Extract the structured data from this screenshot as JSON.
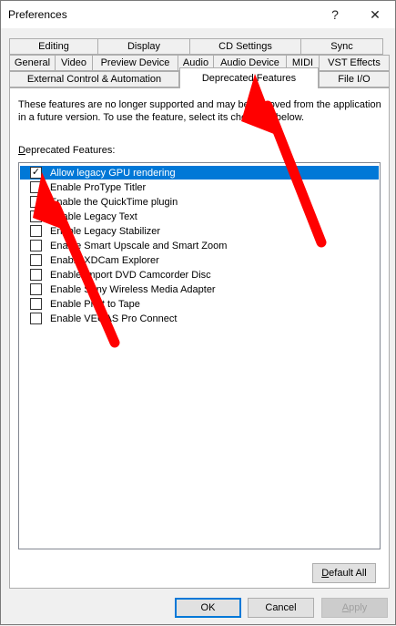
{
  "window": {
    "title": "Preferences",
    "help_glyph": "?",
    "close_glyph": "✕"
  },
  "tabs": {
    "row1": [
      "Editing",
      "Display",
      "CD Settings",
      "Sync"
    ],
    "row2": [
      "General",
      "Video",
      "Preview Device",
      "Audio",
      "Audio Device",
      "MIDI",
      "VST Effects"
    ],
    "row3": [
      "External Control & Automation",
      "Deprecated Features",
      "File I/O"
    ],
    "active": "Deprecated Features"
  },
  "panel": {
    "description": "These features are no longer supported and may be removed from the application in a future version. To use the feature, select its checkbox below.",
    "list_label_mnemonic": "D",
    "list_label_rest": "eprecated Features:",
    "items": [
      {
        "label": "Allow legacy GPU rendering",
        "checked": true,
        "selected": true
      },
      {
        "label": "Enable ProType Titler",
        "checked": false,
        "selected": false
      },
      {
        "label": "Enable the QuickTime plugin",
        "checked": false,
        "selected": false
      },
      {
        "label": "Enable Legacy Text",
        "checked": false,
        "selected": false
      },
      {
        "label": "Enable Legacy Stabilizer",
        "checked": false,
        "selected": false
      },
      {
        "label": "Enable Smart Upscale and Smart Zoom",
        "checked": false,
        "selected": false
      },
      {
        "label": "Enable XDCam Explorer",
        "checked": false,
        "selected": false
      },
      {
        "label": "Enable Import DVD Camcorder Disc",
        "checked": false,
        "selected": false
      },
      {
        "label": "Enable Sony Wireless Media Adapter",
        "checked": false,
        "selected": false
      },
      {
        "label": "Enable Print to Tape",
        "checked": false,
        "selected": false
      },
      {
        "label": "Enable VEGAS Pro Connect",
        "checked": false,
        "selected": false
      }
    ],
    "default_all_mnemonic": "D",
    "default_all_rest": "efault All"
  },
  "buttons": {
    "ok": "OK",
    "cancel": "Cancel",
    "apply_mnemonic": "A",
    "apply_rest": "pply"
  },
  "check_glyph": "✓",
  "colors": {
    "selection": "#0078d7",
    "annotation_arrow": "#ff0000"
  }
}
